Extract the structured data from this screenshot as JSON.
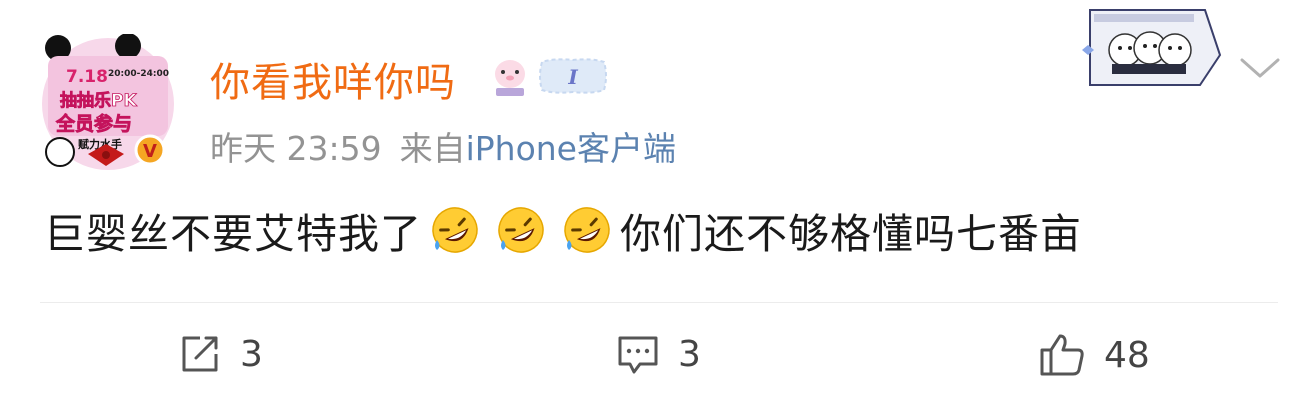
{
  "post": {
    "author": "你看我咩你吗",
    "time": "昨天 23:59",
    "source_prefix": "来自",
    "source_client": "iPhone客户端",
    "content_before": "巨婴丝不要艾特我了",
    "content_emojis": [
      "rofl-emoji",
      "rofl-emoji",
      "rofl-emoji"
    ],
    "content_after": "你们还不够格懂吗七番亩"
  },
  "avatar": {
    "date": "7.18",
    "time": "20:00-24:00",
    "line1": "抽抽乐PK",
    "line2": "全员参与",
    "line3": "赋力水手",
    "badge": "V"
  },
  "level_badge": "I",
  "actions": {
    "repost_count": "3",
    "comment_count": "3",
    "like_count": "48"
  },
  "colors": {
    "username": "#f06b13",
    "meta": "#939393",
    "client": "#5b82b0",
    "verified": "#f5a623"
  }
}
